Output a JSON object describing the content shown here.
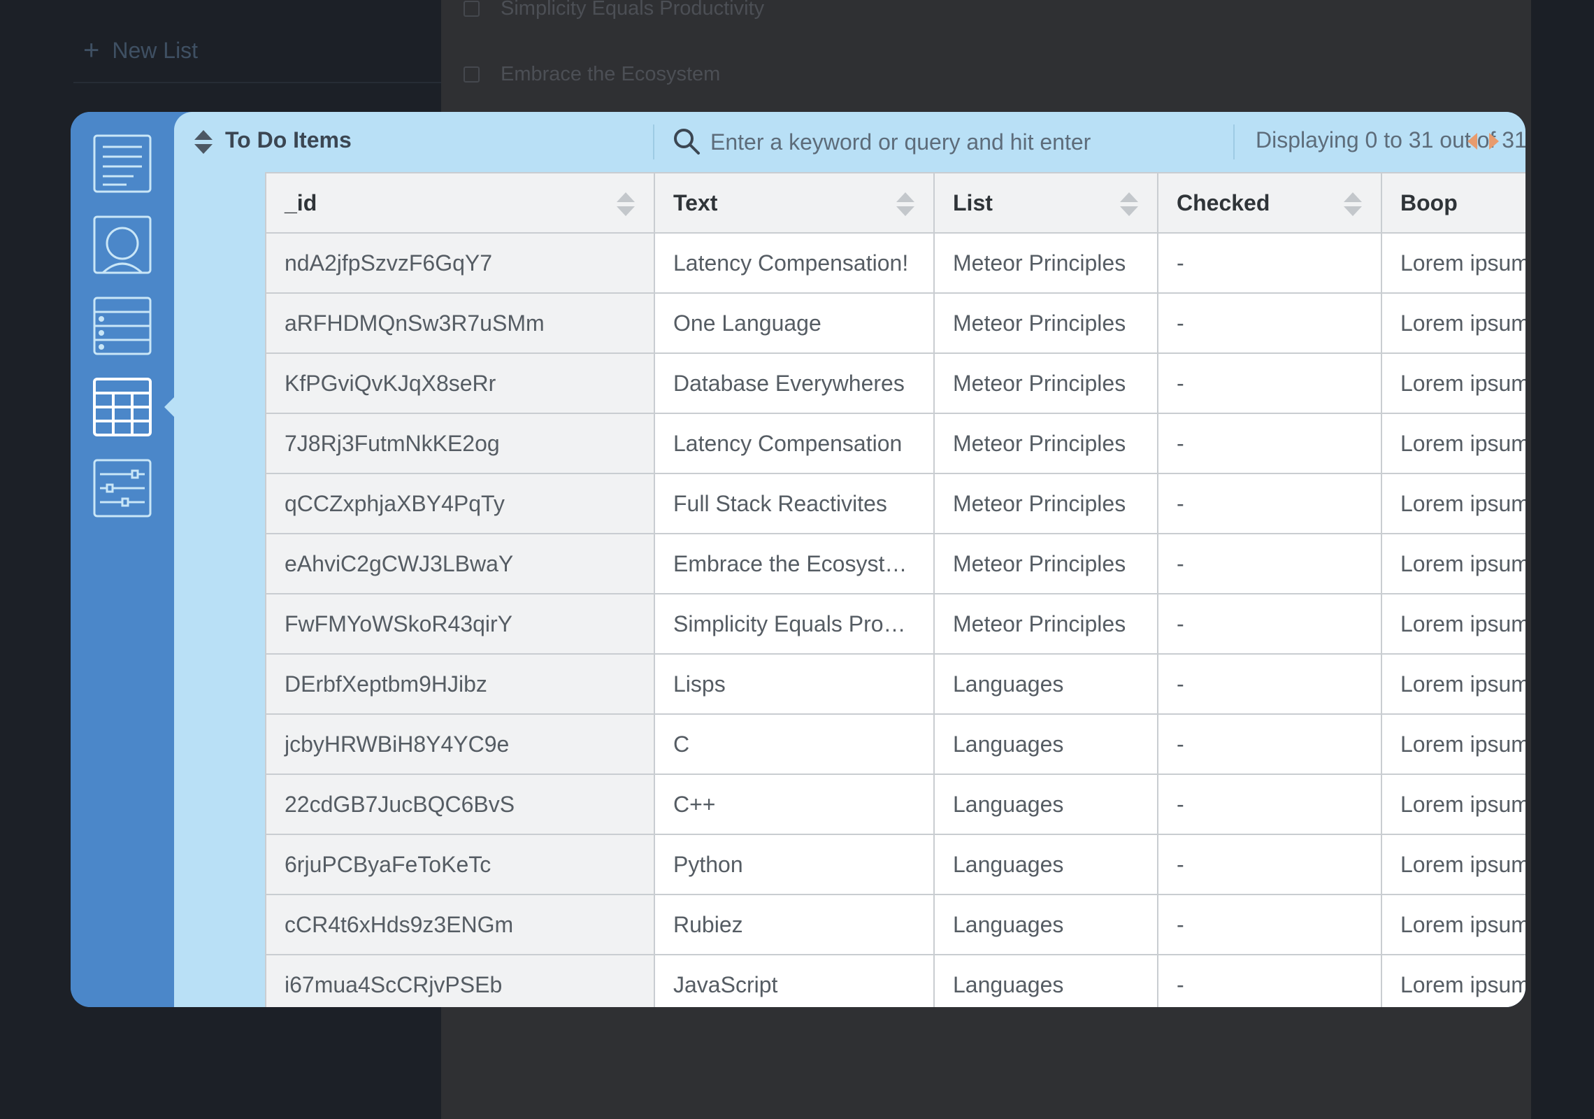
{
  "background": {
    "new_list_label": "New List",
    "tasks": [
      "Simplicity Equals Productivity",
      "Embrace the Ecosystem"
    ]
  },
  "sidebar": {
    "items": [
      {
        "icon": "document-icon",
        "active": false
      },
      {
        "icon": "search-icon",
        "active": false
      },
      {
        "icon": "list-icon",
        "active": false
      },
      {
        "icon": "table-icon",
        "active": true
      },
      {
        "icon": "sliders-icon",
        "active": false
      }
    ]
  },
  "toolbar": {
    "collection_title": "To Do Items",
    "search_placeholder": "Enter a keyword or query and hit enter",
    "display_text": "Displaying 0 to 31 out of 31"
  },
  "table": {
    "columns": [
      "_id",
      "Text",
      "List",
      "Checked",
      "Boop"
    ],
    "rows": [
      [
        "ndA2jfpSzvzF6GqY7",
        "Latency Compensation!",
        "Meteor Principles",
        "-",
        "Lorem ipsum dolor"
      ],
      [
        "aRFHDMQnSw3R7uSMm",
        "One Language",
        "Meteor Principles",
        "-",
        "Lorem ipsum dolor"
      ],
      [
        "KfPGviQvKJqX8seRr",
        "Database Everywheres",
        "Meteor Principles",
        "-",
        "Lorem ipsum dolor"
      ],
      [
        "7J8Rj3FutmNkKE2og",
        "Latency Compensation",
        "Meteor Principles",
        "-",
        "Lorem ipsum dolor"
      ],
      [
        "qCCZxphjaXBY4PqTy",
        "Full Stack Reactivites",
        "Meteor Principles",
        "-",
        "Lorem ipsum dolor"
      ],
      [
        "eAhviC2gCWJ3LBwaY",
        "Embrace the Ecosyst…",
        "Meteor Principles",
        "-",
        "Lorem ipsum dolor"
      ],
      [
        "FwFMYoWSkoR43qirY",
        "Simplicity Equals Pro…",
        "Meteor Principles",
        "-",
        "Lorem ipsum dolor"
      ],
      [
        "DErbfXeptbm9HJibz",
        "Lisps",
        "Languages",
        "-",
        "Lorem ipsum dolor"
      ],
      [
        "jcbyHRWBiH8Y4YC9e",
        "C",
        "Languages",
        "-",
        "Lorem ipsum dolor"
      ],
      [
        "22cdGB7JucBQC6BvS",
        "C++",
        "Languages",
        "-",
        "Lorem ipsum dolor"
      ],
      [
        "6rjuPCByaFeToKeTc",
        "Python",
        "Languages",
        "-",
        "Lorem ipsum dolor"
      ],
      [
        "cCR4t6xHds9z3ENGm",
        "Rubiez",
        "Languages",
        "-",
        "Lorem ipsum dolor"
      ],
      [
        "i67mua4ScCRjvPSEb",
        "JavaScript",
        "Languages",
        "-",
        "Lorem ipsum dolor"
      ]
    ]
  },
  "colors": {
    "sidebar_blue": "#4b87c9",
    "panel_light_blue": "#b9e0f6",
    "pager_arrow": "#e89b6d"
  }
}
